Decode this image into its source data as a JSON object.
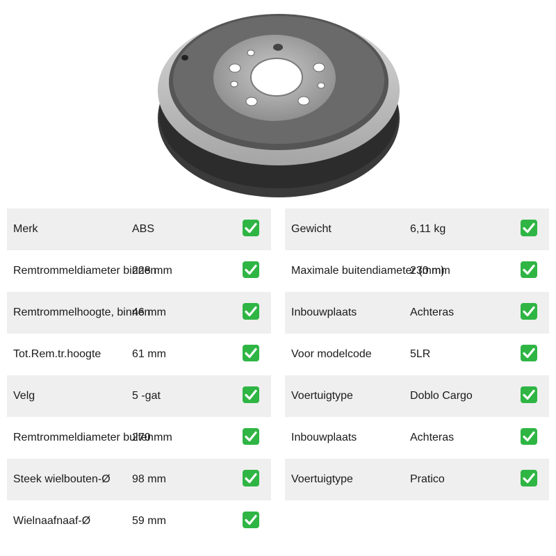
{
  "product_image": {
    "icon": "brake-drum-image"
  },
  "colors": {
    "check_bg": "#2fb544",
    "row_alt_bg": "#efefef",
    "text": "#1a1a1a"
  },
  "specs_left": [
    {
      "label": "Merk",
      "value": "ABS"
    },
    {
      "label": "Remtrommeldiameter binnen",
      "value": "228 mm"
    },
    {
      "label": "Remtrommelhoogte, binnen",
      "value": "46 mm"
    },
    {
      "label": "Tot.Rem.tr.hoogte",
      "value": "61 mm"
    },
    {
      "label": "Velg",
      "value": "5 -gat"
    },
    {
      "label": "Remtrommeldiameter buiten",
      "value": "270 mm"
    },
    {
      "label": "Steek wielbouten-Ø",
      "value": "98 mm"
    },
    {
      "label": "Wielnaafnaaf-Ø",
      "value": "59 mm"
    }
  ],
  "specs_right": [
    {
      "label": "Gewicht",
      "value": "6,11 kg"
    },
    {
      "label": "Maximale buitendiameter (mm)",
      "value": "230 mm"
    },
    {
      "label": "Inbouwplaats",
      "value": "Achteras"
    },
    {
      "label": "Voor modelcode",
      "value": "5LR"
    },
    {
      "label": "Voertuigtype",
      "value": "Doblo Cargo"
    },
    {
      "label": "Inbouwplaats",
      "value": "Achteras"
    },
    {
      "label": "Voertuigtype",
      "value": "Pratico"
    }
  ]
}
